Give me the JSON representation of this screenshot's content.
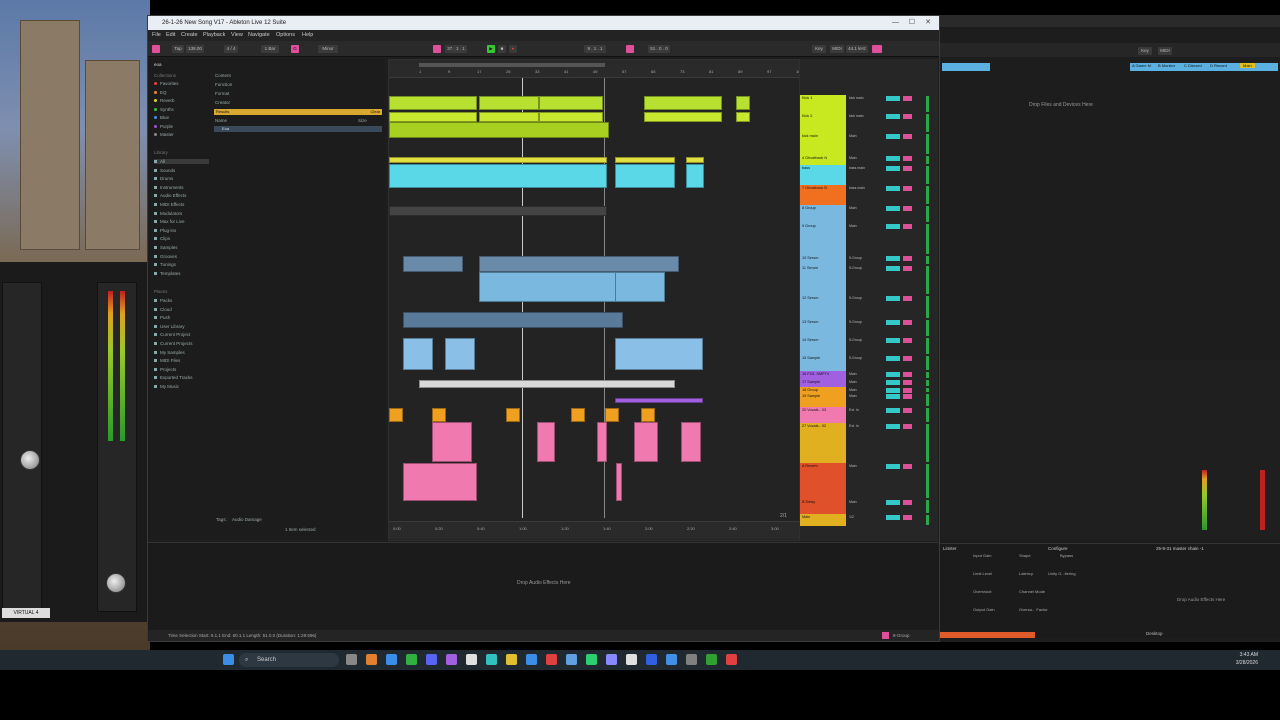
{
  "window": {
    "title": "26-1-26 New Song V17 - Ableton Live 12 Suite",
    "min": "—",
    "max": "☐",
    "close": "✕"
  },
  "menu": [
    "File",
    "Edit",
    "Create",
    "Playback",
    "View",
    "Navigate",
    "Options",
    "Help"
  ],
  "toolbar": {
    "tap": "Tap",
    "tempo": "138.00",
    "sig": "4 / 4",
    "bar": "1 Bar",
    "key": "G",
    "scale": "Minor",
    "position": "37 . 1 . 1",
    "loop_start": "9 . 1 . 1",
    "loop_len": "51 . 0 . 0",
    "key_btn": "Key",
    "midi_btn": "MIDI",
    "sample_rate": "44.1 kHz"
  },
  "browser": {
    "search": "eoa",
    "collections_title": "Collections",
    "collections": [
      {
        "label": "Favorites",
        "color": "#e84040"
      },
      {
        "label": "EQ",
        "color": "#e88a30"
      },
      {
        "label": "Reverb",
        "color": "#e8d030"
      },
      {
        "label": "Synths",
        "color": "#40c040"
      },
      {
        "label": "Blue",
        "color": "#4090e8"
      },
      {
        "label": "Purple",
        "color": "#a050e0"
      },
      {
        "label": "Master",
        "color": "#888888"
      }
    ],
    "library_title": "Library",
    "library": [
      "All",
      "Sounds",
      "Drums",
      "Instruments",
      "Audio Effects",
      "MIDI Effects",
      "Modulators",
      "Max for Live",
      "Plug-ins",
      "Clips",
      "Samples",
      "Grooves",
      "Tunings",
      "Templates"
    ],
    "places_title": "Places",
    "places": [
      "Packs",
      "Cloud",
      "Push",
      "User Library",
      "Current Project",
      "Current Projects",
      "My Samples",
      "MIDI Files",
      "Projects",
      "Exported Tracks",
      "My Music"
    ],
    "filters": [
      "Content",
      "Function",
      "Format",
      "Creator"
    ],
    "results_label": "Results",
    "clear_label": "Clear",
    "name_col": "Name",
    "size_col": "Size",
    "result_row": "Eoa",
    "tags_label": "Tags:",
    "tags_value": "Audio Damage",
    "selection_info": "1 Item selected"
  },
  "arrangement": {
    "ruler": [
      "1",
      "9",
      "17",
      "25",
      "33",
      "41",
      "49",
      "57",
      "65",
      "73",
      "81",
      "89",
      "97",
      "105"
    ],
    "time_ruler": [
      "0:00",
      "0:20",
      "0:40",
      "1:00",
      "1:20",
      "1:40",
      "2:00",
      "2:20",
      "2:40",
      "3:00"
    ],
    "zoom_label": "2/1"
  },
  "tracks": [
    {
      "name": "Kick 1",
      "color": "#c8e820",
      "route": "kick main"
    },
    {
      "name": "Kick 2",
      "color": "#c8e820",
      "route": "kick main"
    },
    {
      "name": "kick main",
      "color": "#c8e820",
      "route": "Main"
    },
    {
      "name": "4 Ghosthack N",
      "color": "#c8e820",
      "route": "Main"
    },
    {
      "name": "bass",
      "color": "#5ad8e8",
      "route": "bass main"
    },
    {
      "name": "7 Ghosthack B",
      "color": "#f07020",
      "route": "bass main"
    },
    {
      "name": "8 Group",
      "color": "#7ab8e0",
      "route": "Main"
    },
    {
      "name": "9 Group",
      "color": "#7ab8e0",
      "route": "Main"
    },
    {
      "name": "10 Serum",
      "color": "#7ab8e0",
      "route": "9-Group"
    },
    {
      "name": "11 Serum",
      "color": "#7ab8e0",
      "route": "9-Group"
    },
    {
      "name": "12 Serum",
      "color": "#7ab8e0",
      "route": "9-Group"
    },
    {
      "name": "13 Serum",
      "color": "#7ab8e0",
      "route": "9-Group"
    },
    {
      "name": "14 Serum",
      "color": "#7ab8e0",
      "route": "9-Group"
    },
    {
      "name": "15 Sample",
      "color": "#7ab8e0",
      "route": "9-Group"
    },
    {
      "name": "16 FX3. SMPTV",
      "color": "#a060e0",
      "route": "Main"
    },
    {
      "name": "17 Sample",
      "color": "#a060e0",
      "route": "Main"
    },
    {
      "name": "18 Group",
      "color": "#f0a020",
      "route": "Main"
    },
    {
      "name": "19 Sample",
      "color": "#f0a020",
      "route": "Main"
    },
    {
      "name": "20 Vocals - 03",
      "color": "#f07ab0",
      "route": "Ext. In"
    },
    {
      "name": "27 Vocals - 02",
      "color": "#e0b020",
      "route": "Ext. In"
    },
    {
      "name": "A Reverb",
      "color": "#e0502a",
      "route": "Main"
    },
    {
      "name": "B Delay",
      "color": "#e0502a",
      "route": "Main"
    },
    {
      "name": "Main",
      "color": "#e0b020",
      "route": "1/2"
    }
  ],
  "devices": {
    "drop_hint": "Drop Audio Effects Here"
  },
  "status": {
    "text": "Time Selection   Start: 9.1.1   End: 60.1.1   Length: 51.0.0  (Duration: 1:28:696)",
    "group_label": "8-Group"
  },
  "right_window": {
    "drop_hint": "Drop Files and Devices Here",
    "limiter_title": "Limiter",
    "configure": "Configure",
    "input_gain": "Input Gain",
    "shape": "Shape",
    "bypass": "Bypass",
    "limit_level": "Limit Level",
    "latency": "Latency",
    "unity": "Unity G...ltering",
    "overshoot": "Overshoot",
    "channel_mode": "Channel Mode",
    "output_gain": "Output Gain",
    "oversampling": "Oversa... Factor",
    "chain_title": "25-9-31 master chain -1",
    "drop_hint2": "Drop Audio Effects Here",
    "desktop_label": "Desktop",
    "sends": [
      "A Game M",
      "B Monitor",
      "C Discord",
      "D Record"
    ],
    "main_label": "Main"
  },
  "uad": {
    "label": "VIRTUAL 4"
  },
  "taskbar": {
    "search": "Search",
    "time": "3:43 AM",
    "date": "3/28/2026"
  }
}
